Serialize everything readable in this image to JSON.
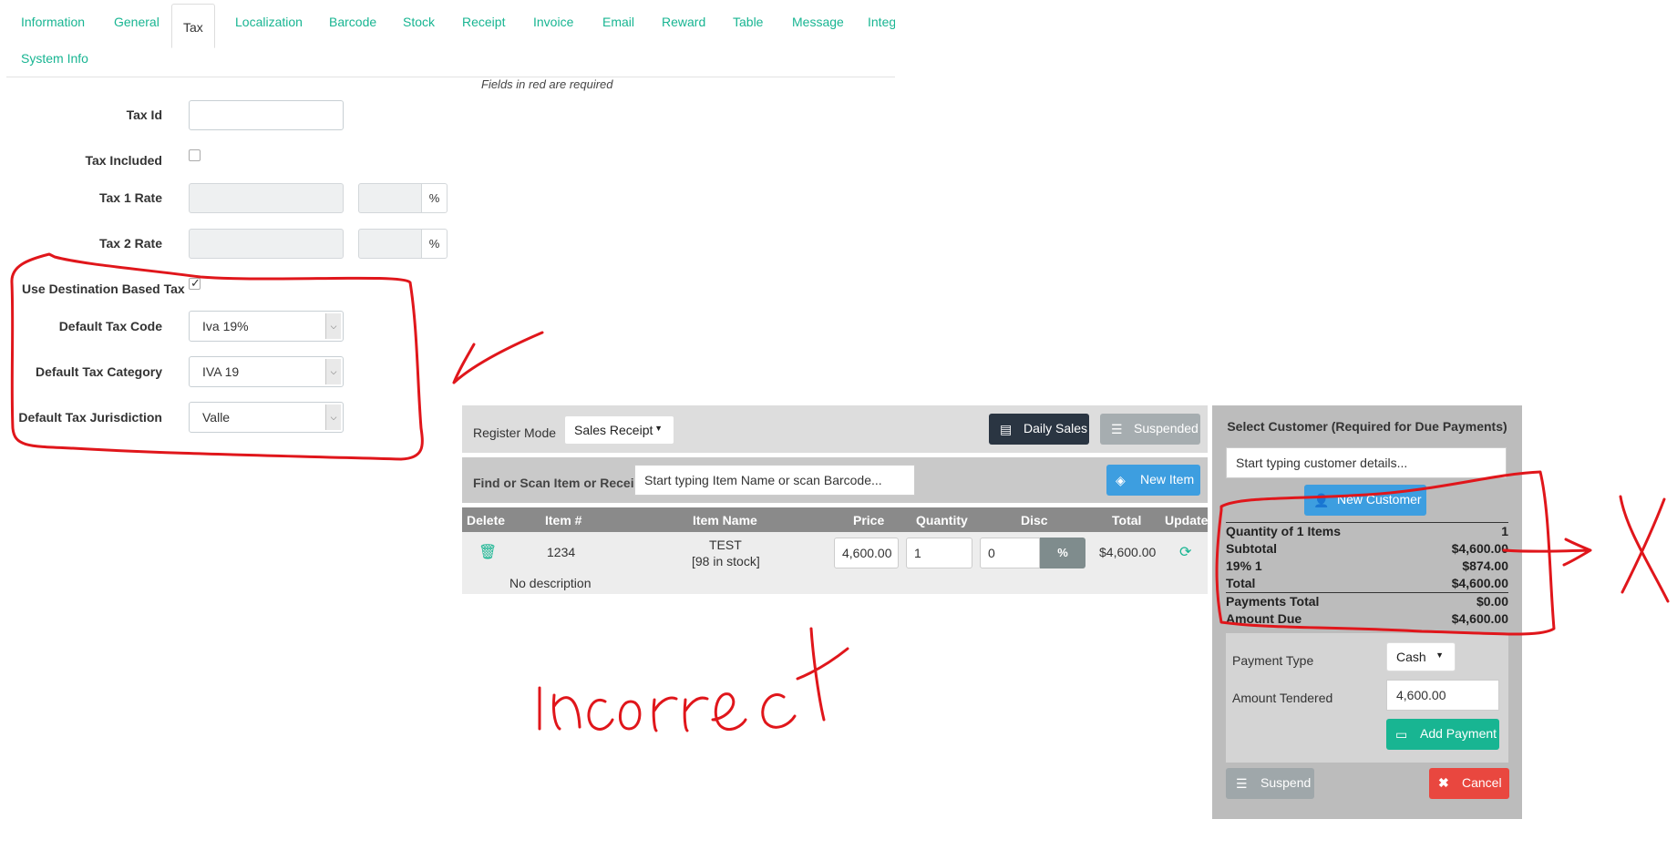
{
  "tabs": {
    "items": [
      "Information",
      "General",
      "Tax",
      "Localization",
      "Barcode",
      "Stock",
      "Receipt",
      "Invoice",
      "Email",
      "Reward",
      "Table",
      "Message",
      "Integ"
    ],
    "second_row": "System Info",
    "active": "Tax"
  },
  "form": {
    "required_note": "Fields in red are required",
    "tax_id_label": "Tax Id",
    "tax_id_value": "",
    "tax_included_label": "Tax Included",
    "tax_included_checked": false,
    "tax1_label": "Tax 1 Rate",
    "tax2_label": "Tax 2 Rate",
    "percent_symbol": "%",
    "dest_tax_label": "Use Destination Based Tax",
    "dest_tax_checked": true,
    "tax_code_label": "Default Tax Code",
    "tax_code_value": "Iva 19%",
    "tax_category_label": "Default Tax Category",
    "tax_category_value": "IVA 19",
    "tax_jurisdiction_label": "Default Tax Jurisdiction",
    "tax_jurisdiction_value": "Valle"
  },
  "register": {
    "mode_label": "Register Mode",
    "mode_value": "Sales Receipt",
    "daily_sales": "Daily Sales",
    "suspended": "Suspended",
    "find_label": "Find or Scan Item or Receipt",
    "find_placeholder": "Start typing Item Name or scan Barcode...",
    "new_item": "New Item",
    "columns": [
      "Delete",
      "Item #",
      "Item Name",
      "Price",
      "Quantity",
      "Disc",
      "Total",
      "Update"
    ],
    "row": {
      "item_number": "1234",
      "item_name": "TEST",
      "stock": "[98 in stock]",
      "price": "4,600.00",
      "quantity": "1",
      "discount": "0",
      "discount_type": "%",
      "total": "$4,600.00",
      "description": "No description"
    }
  },
  "customer": {
    "header": "Select Customer (Required for Due Payments)",
    "placeholder": "Start typing customer details...",
    "new_customer": "New Customer",
    "summary": [
      {
        "label": "Quantity of 1 Items",
        "value": "1"
      },
      {
        "label": "Subtotal",
        "value": "$4,600.00"
      },
      {
        "label": "19% 1",
        "value": "$874.00"
      },
      {
        "label": "Total",
        "value": "$4,600.00"
      },
      {
        "label": "Payments Total",
        "value": "$0.00"
      },
      {
        "label": "Amount Due",
        "value": "$4,600.00"
      }
    ],
    "payment_type_label": "Payment Type",
    "payment_type_value": "Cash",
    "amount_tendered_label": "Amount Tendered",
    "amount_tendered_value": "4,600.00",
    "add_payment": "Add Payment",
    "suspend": "Suspend",
    "cancel": "Cancel"
  },
  "colors": {
    "accent": "#18b592",
    "dark_button": "#2a3542",
    "blue_button": "#3d9ee0",
    "red_button": "#e9473f",
    "annotation": "#e0161b"
  }
}
